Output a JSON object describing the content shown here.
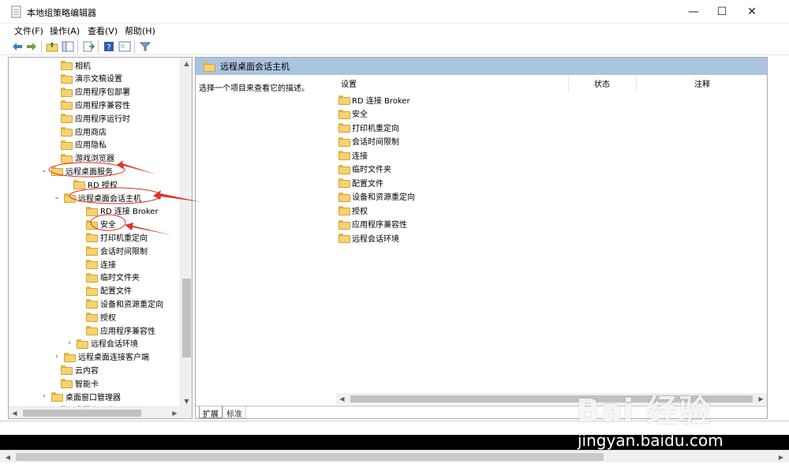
{
  "window": {
    "title": "本地组策略编辑器",
    "minimize": "—",
    "maximize": "☐",
    "close": "✕"
  },
  "menu": [
    "文件(F)",
    "操作(A)",
    "查看(V)",
    "帮助(H)"
  ],
  "tree": [
    {
      "label": "相机",
      "expander": ""
    },
    {
      "label": "演示文稿设置",
      "expander": ""
    },
    {
      "label": "应用程序包部署",
      "expander": ""
    },
    {
      "label": "应用程序兼容性",
      "expander": ""
    },
    {
      "label": "应用程序运行时",
      "expander": ""
    },
    {
      "label": "应用商店",
      "expander": ""
    },
    {
      "label": "应用隐私",
      "expander": ""
    },
    {
      "label": "游戏浏览器",
      "expander": ""
    },
    {
      "label": "远程桌面服务",
      "expander": "⌄"
    },
    {
      "label": "RD 授权",
      "expander": ""
    },
    {
      "label": "远程桌面会话主机",
      "expander": "⌄"
    },
    {
      "label": "RD 连接 Broker",
      "expander": ""
    },
    {
      "label": "安全",
      "expander": ""
    },
    {
      "label": "打印机重定向",
      "expander": ""
    },
    {
      "label": "会话时间限制",
      "expander": ""
    },
    {
      "label": "连接",
      "expander": ""
    },
    {
      "label": "临时文件夹",
      "expander": ""
    },
    {
      "label": "配置文件",
      "expander": ""
    },
    {
      "label": "设备和资源重定向",
      "expander": ""
    },
    {
      "label": "授权",
      "expander": ""
    },
    {
      "label": "应用程序兼容性",
      "expander": ""
    },
    {
      "label": "远程会话环境",
      "expander": "›"
    },
    {
      "label": "远程桌面连接客户端",
      "expander": "›"
    },
    {
      "label": "云内容",
      "expander": ""
    },
    {
      "label": "智能卡",
      "expander": ""
    },
    {
      "label": "桌面窗口管理器",
      "expander": "›"
    },
    {
      "label": "桌面小工具",
      "expander": ""
    }
  ],
  "right": {
    "header": "远程桌面会话主机",
    "description": "选择一个项目来查看它的描述。",
    "columns": [
      "设置",
      "状态",
      "注释"
    ],
    "items": [
      "RD 连接 Broker",
      "安全",
      "打印机重定向",
      "会话时间限制",
      "连接",
      "临时文件夹",
      "配置文件",
      "设备和资源重定向",
      "授权",
      "应用程序兼容性",
      "远程会话环境"
    ]
  },
  "tabs": [
    "扩展",
    "标准"
  ],
  "watermark": {
    "logo": "Bai 经验",
    "url": "jingyan.baidu.com"
  }
}
